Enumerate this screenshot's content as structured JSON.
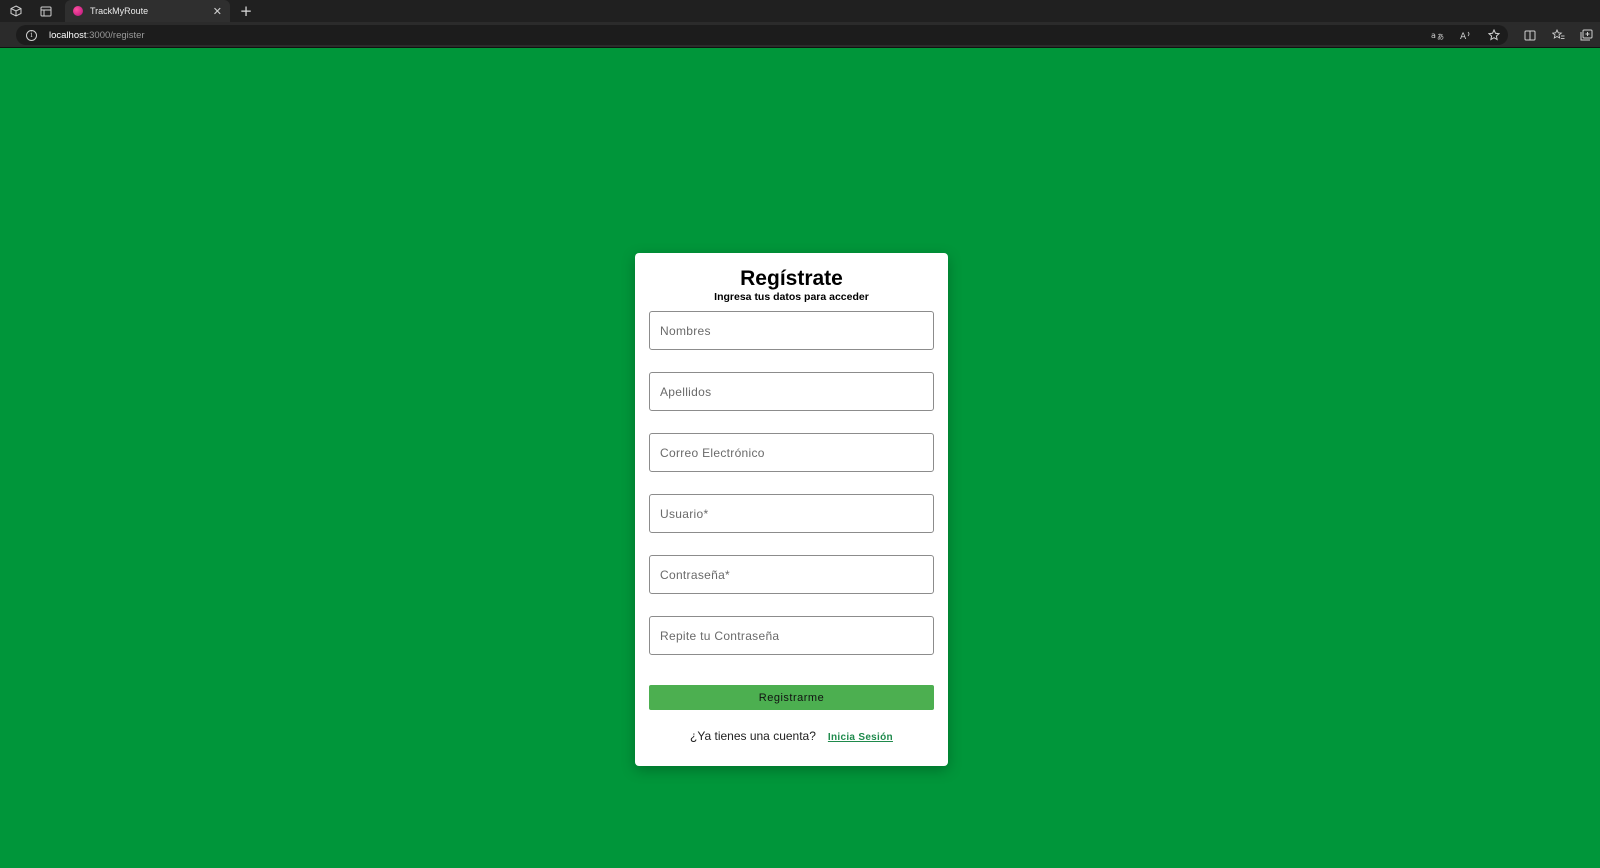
{
  "browser": {
    "tab_title": "TrackMyRoute",
    "url_host": "localhost",
    "url_path": ":3000/register",
    "colors": {
      "tabbar": "#202020",
      "addressbar": "#2b2b2b"
    }
  },
  "page": {
    "background_color": "#00963a",
    "title": "Regístrate",
    "subtitle": "Ingresa tus datos para acceder",
    "fields": [
      {
        "placeholder": "Nombres",
        "value": ""
      },
      {
        "placeholder": "Apellidos",
        "value": ""
      },
      {
        "placeholder": "Correo Electrónico",
        "value": ""
      },
      {
        "placeholder": "Usuario*",
        "value": ""
      },
      {
        "placeholder": "Contraseña*",
        "value": ""
      },
      {
        "placeholder": "Repite tu Contraseña",
        "value": ""
      }
    ],
    "submit_label": "Registrarme",
    "submit_color": "#4caf50",
    "footer_text": "¿Ya tienes una cuenta?",
    "login_link": "Inicia Sesión",
    "link_color": "#1f8a4c"
  }
}
